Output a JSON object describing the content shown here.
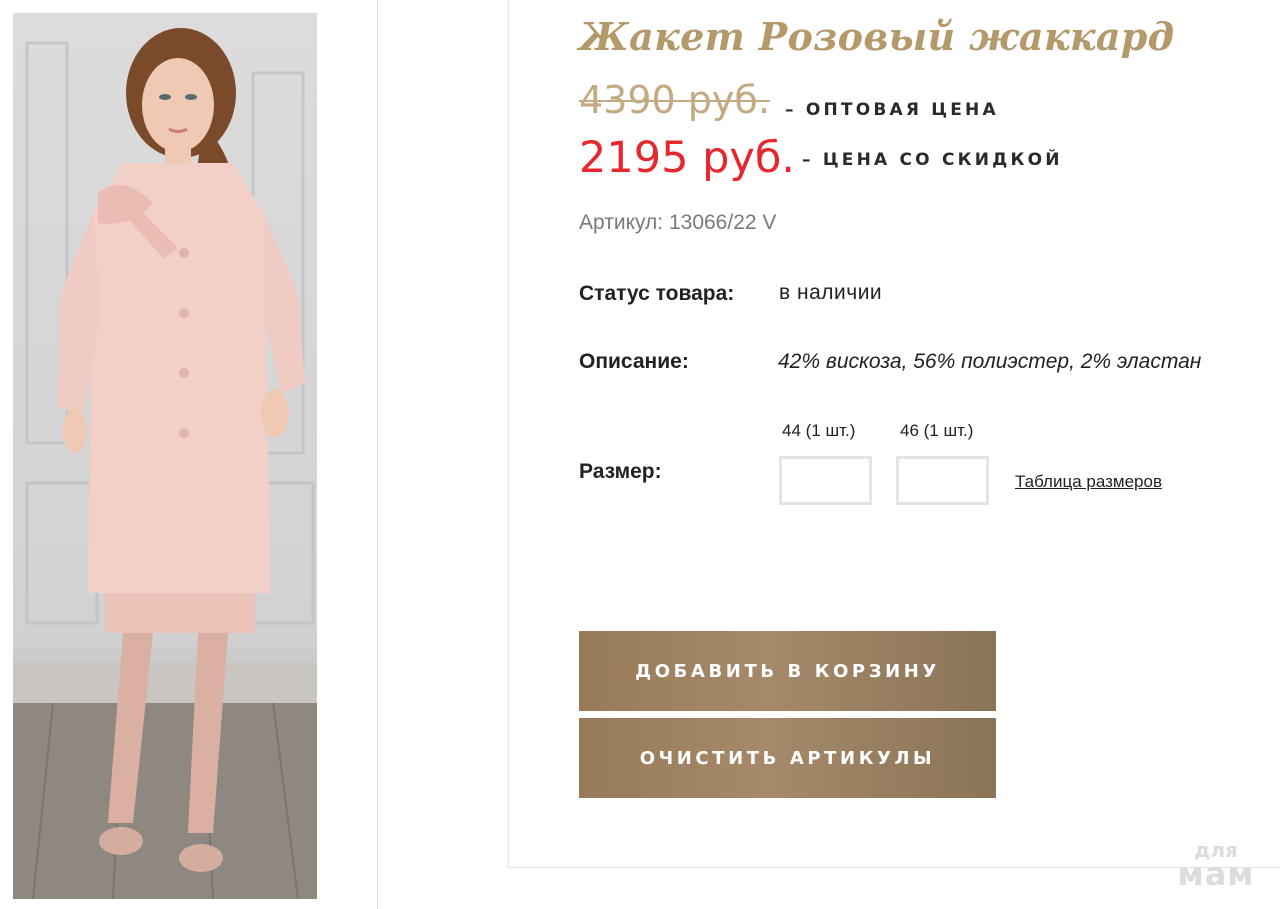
{
  "product": {
    "title": "Жакет Розовый жаккард",
    "old_price": "4390 руб.",
    "old_price_label": "– ОПТОВАЯ ЦЕНА",
    "new_price": "2195 руб.",
    "new_price_label": "– ЦЕНА СО СКИДКОЙ",
    "sku": "Артикул: 13066/22 V",
    "status_label": "Статус товара:",
    "status_value": "в наличии",
    "description_label": "Описание:",
    "description_value": "42% вискоза, 56% полиэстер, 2% эластан",
    "size_label": "Размер:",
    "sizes": [
      {
        "header": "44 (1 шт.)",
        "value": ""
      },
      {
        "header": "46 (1 шт.)",
        "value": ""
      }
    ],
    "size_table_link": "Таблица размеров"
  },
  "actions": {
    "add_to_cart": "ДОБАВИТЬ В КОРЗИНУ",
    "clear_skus": "ОЧИСТИТЬ АРТИКУЛЫ"
  },
  "watermark": {
    "line1": "для",
    "line2": "мам"
  },
  "colors": {
    "accent_gold": "#b4996a",
    "sale_red": "#e8262d",
    "button_brown": "#977a57"
  },
  "icons": {
    "product_photo": "pink-jacquard-coat-photo"
  }
}
